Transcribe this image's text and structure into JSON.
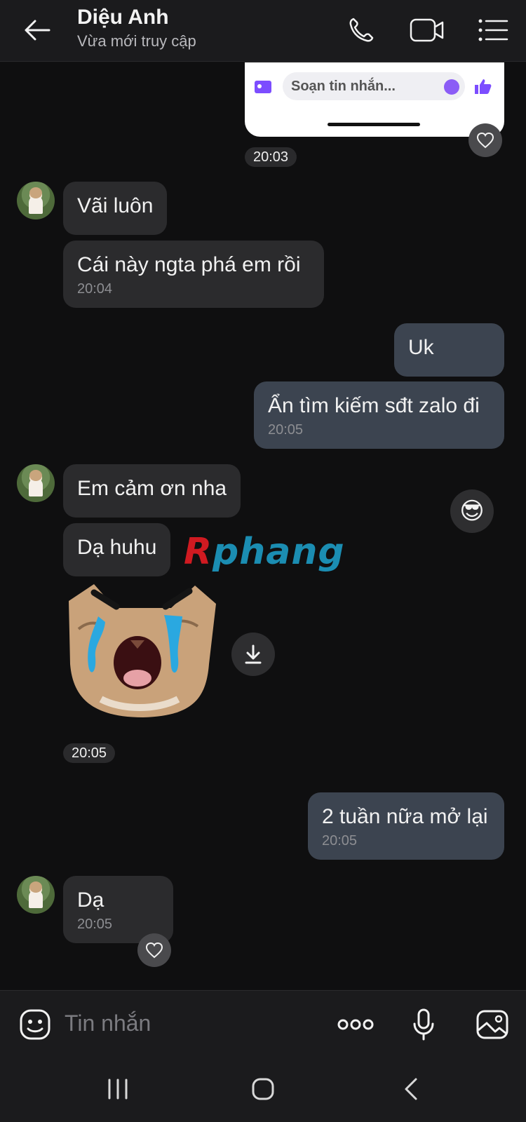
{
  "header": {
    "contact_name": "Diệu Anh",
    "status": "Vừa mới truy cập",
    "icons": [
      "back-arrow-icon",
      "phone-icon",
      "video-camera-icon",
      "menu-list-icon"
    ]
  },
  "preview": {
    "input_placeholder": "Soạn tin nhắn..."
  },
  "timestamps": {
    "t1": "20:03",
    "t2": "20:05"
  },
  "messages": [
    {
      "side": "in",
      "text": "Vãi luôn",
      "time": ""
    },
    {
      "side": "in",
      "text": "Cái này ngta phá em rồi",
      "time": "20:04"
    },
    {
      "side": "out",
      "text": "Uk",
      "time": ""
    },
    {
      "side": "out",
      "text": "Ẩn tìm kiếm sđt zalo đi",
      "time": "20:05"
    },
    {
      "side": "in",
      "text": "Em cảm ơn nha",
      "time": ""
    },
    {
      "side": "in",
      "text": "Dạ huhu",
      "time": ""
    },
    {
      "side": "out",
      "text": "2 tuần nữa mở lại",
      "time": "20:05"
    },
    {
      "side": "in",
      "text": "Dạ",
      "time": "20:05"
    }
  ],
  "watermark": {
    "first": "R",
    "rest": "phang"
  },
  "reaction_emoji": "😎",
  "input": {
    "placeholder": "Tin nhắn",
    "more_label": "ooo"
  },
  "colors": {
    "incoming_bubble": "#2b2b2d",
    "outgoing_bubble": "#3c4450",
    "background": "#0f0f10"
  }
}
